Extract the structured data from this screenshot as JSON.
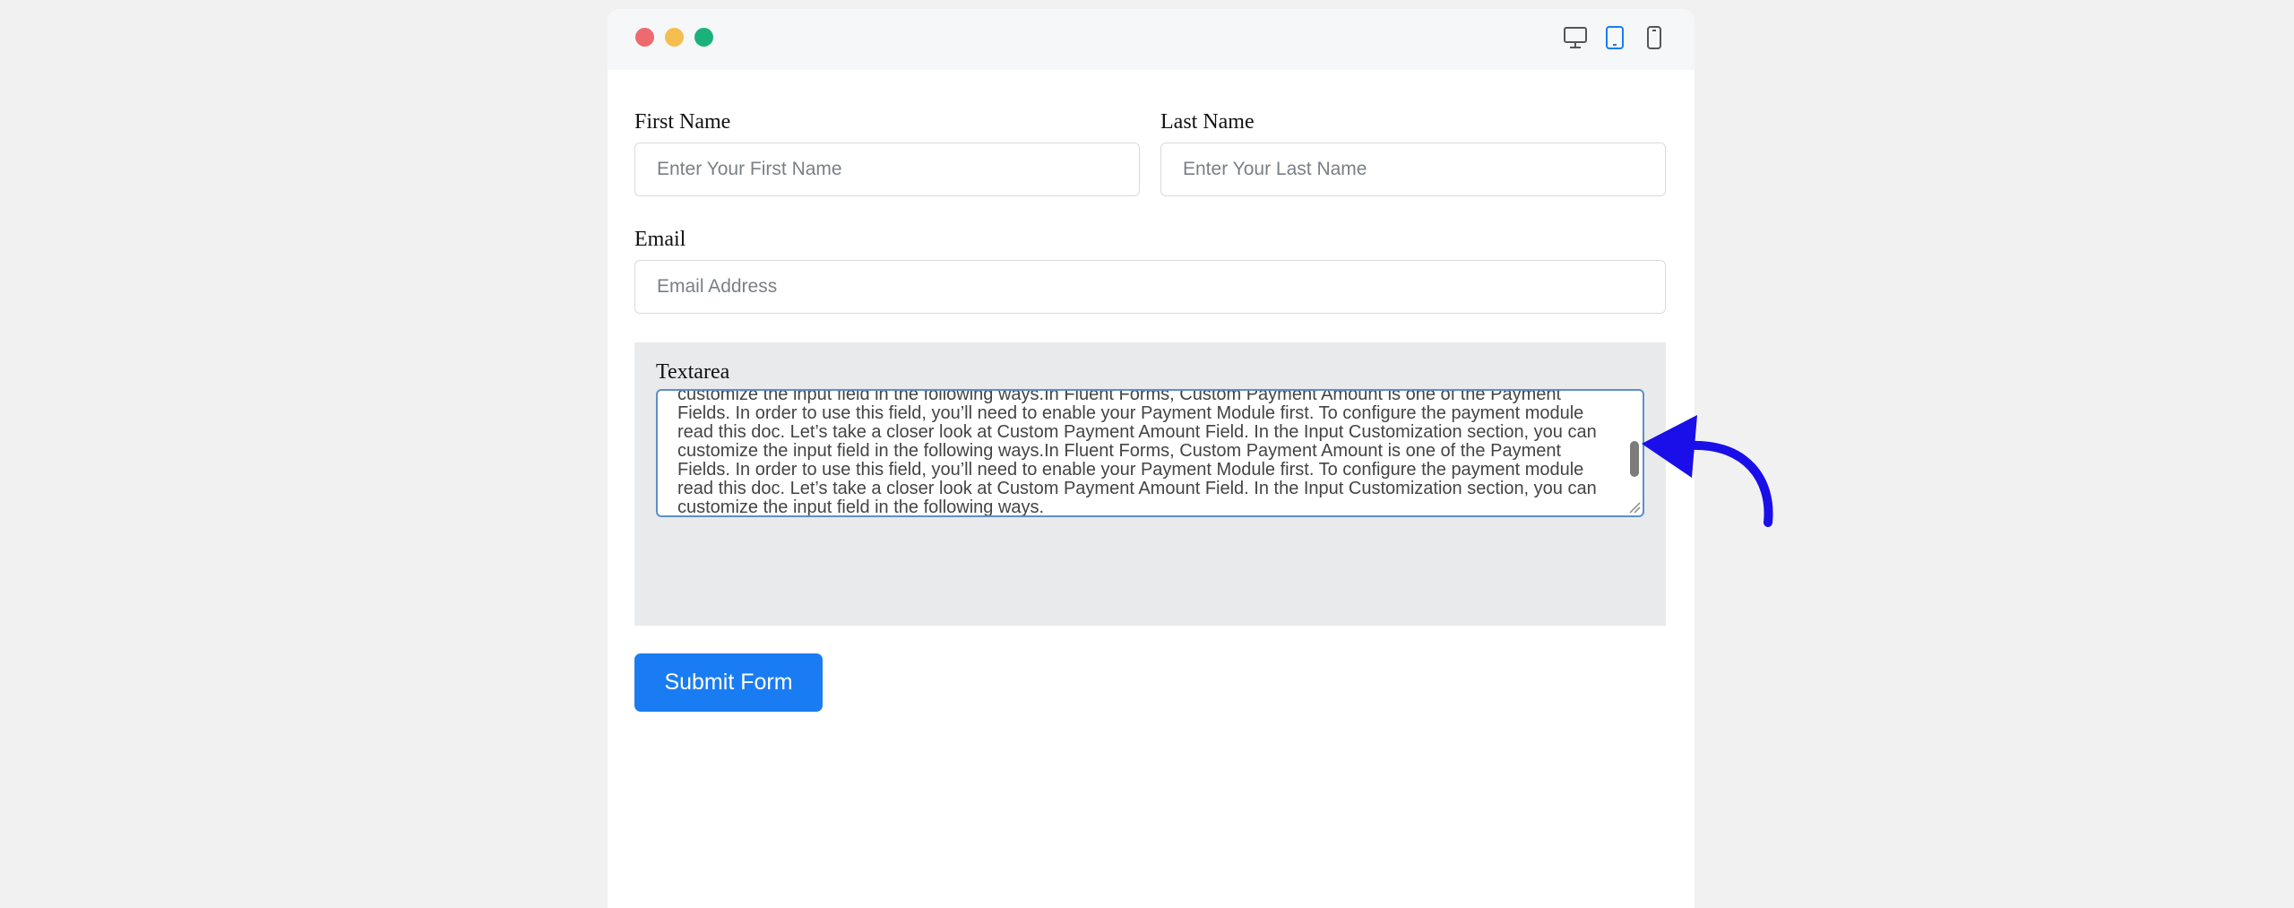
{
  "form": {
    "first_name": {
      "label": "First Name",
      "placeholder": "Enter Your First Name"
    },
    "last_name": {
      "label": "Last Name",
      "placeholder": "Enter Your Last Name"
    },
    "email": {
      "label": "Email",
      "placeholder": "Email Address"
    },
    "textarea": {
      "label": "Textarea",
      "value": "customize the input field in the following ways.In Fluent Forms, Custom Payment Amount is one of the Payment Fields. In order to use this field, you’ll need to enable your Payment Module first. To configure the payment module read this doc. Let’s take a closer look at Custom Payment Amount Field. In the Input Customization section, you can customize the input field in the following ways.In Fluent Forms, Custom Payment Amount is one of the Payment Fields. In order to use this field, you’ll need to enable your Payment Module first. To configure the payment module read this doc. Let’s take a closer look at Custom Payment Amount Field. In the Input Customization section, you can customize the input field in the following ways."
    },
    "submit_label": "Submit Form"
  },
  "preview": {
    "window_dots": [
      "close-dot",
      "minimize-dot",
      "maximize-dot"
    ],
    "device_icons": [
      "desktop-icon",
      "tablet-icon",
      "mobile-icon"
    ],
    "active_device": "tablet"
  },
  "colors": {
    "accent": "#1a7cf2",
    "annotation_arrow": "#1a0fe8"
  }
}
